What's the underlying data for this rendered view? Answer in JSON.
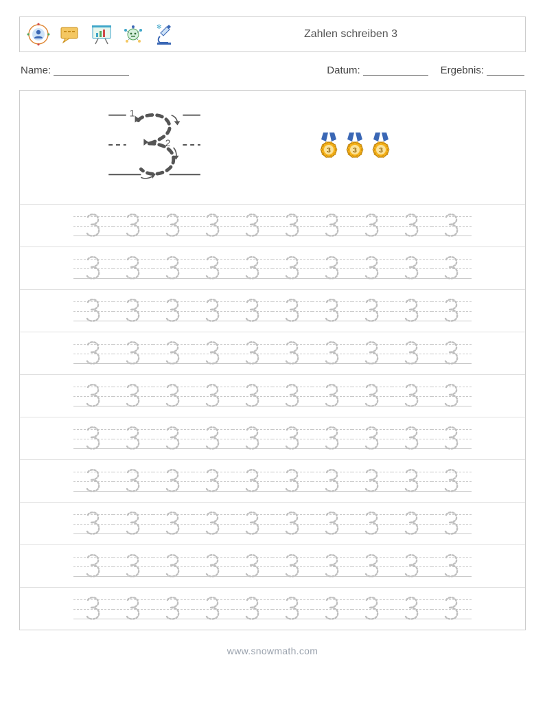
{
  "header": {
    "title": "Zahlen schreiben 3",
    "icons": [
      "user-target-icon",
      "chat-icon",
      "presentation-icon",
      "robot-icon",
      "microscope-icon"
    ]
  },
  "meta": {
    "name_label": "Name:",
    "date_label": "Datum:",
    "result_label": "Ergebnis:"
  },
  "demo": {
    "stroke1": "1",
    "stroke2": "2",
    "medal_count": 3,
    "medal_number": "3"
  },
  "practice": {
    "digit": "3",
    "rows": 10,
    "columns": 10
  },
  "footer": {
    "site": "www.snowmath.com"
  },
  "colors": {
    "trace": "#bfbfbf",
    "guide": "#c8c8c8",
    "medal_ribbon": "#3a67b5",
    "medal_gold": "#f6b21a",
    "demo_stroke": "#555555"
  }
}
